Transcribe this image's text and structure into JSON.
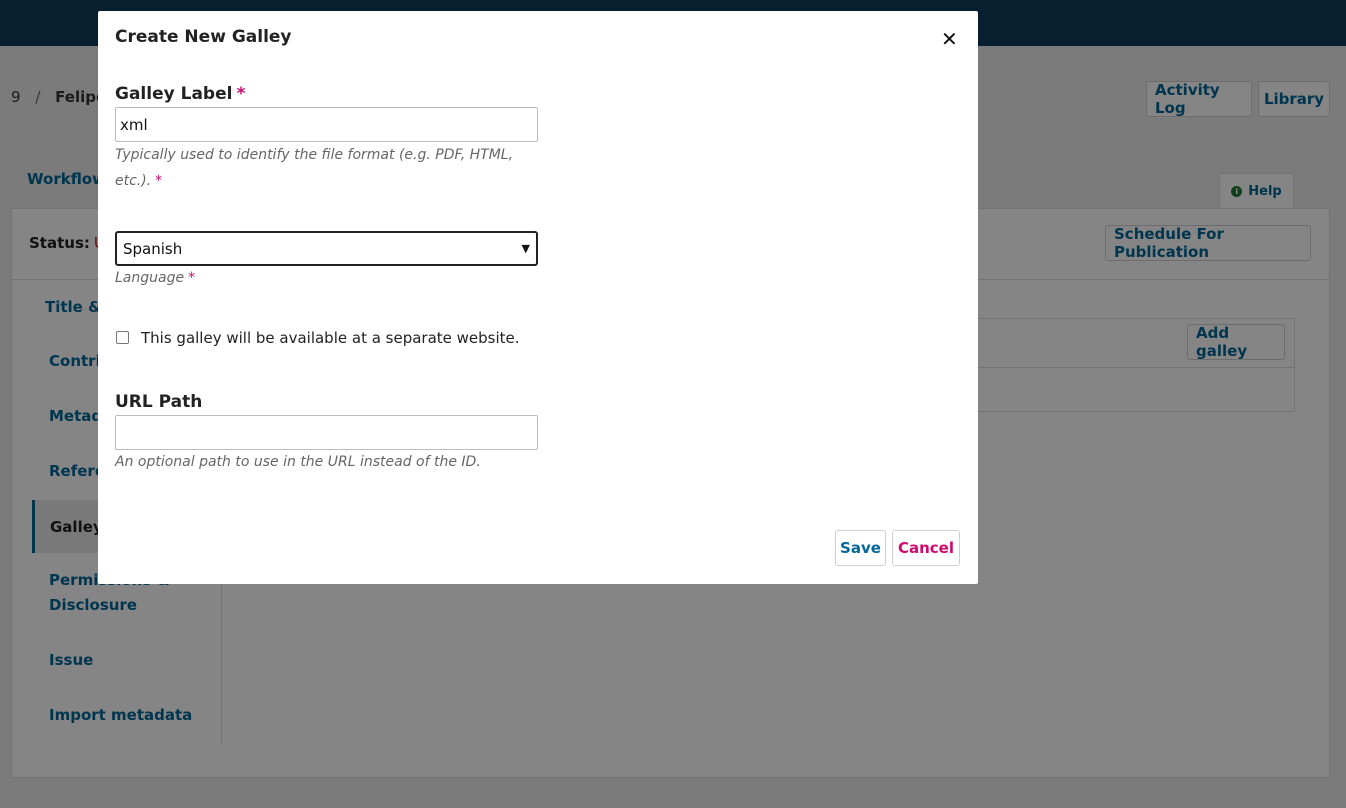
{
  "page": {
    "breadcrumb": {
      "id": "9",
      "separator": "/",
      "author": "Felipe"
    },
    "header_buttons": {
      "activity_log": "Activity Log",
      "library": "Library"
    },
    "tabs": {
      "workflow": "Workflow"
    },
    "help": {
      "label": "Help",
      "icon": "info-icon"
    },
    "status": {
      "label": "Status:",
      "value": "U"
    },
    "schedule_button": "Schedule For Publication",
    "sidebar": {
      "items": [
        {
          "label": "Title &"
        },
        {
          "label": "Contri"
        },
        {
          "label": "Metad"
        },
        {
          "label": "Refere"
        },
        {
          "label": "Galley"
        },
        {
          "label": "Permissions &"
        },
        {
          "label": "Disclosure"
        },
        {
          "label": "Issue"
        },
        {
          "label": "Import metadata"
        }
      ]
    },
    "galleys": {
      "add_button": "Add galley"
    }
  },
  "modal": {
    "title": "Create New Galley",
    "close_icon": "close-icon",
    "galley_label": {
      "label": "Galley Label",
      "required_mark": "*",
      "value": "xml",
      "description_line1": "Typically used to identify the file format (e.g. PDF, HTML,",
      "description_line2": "etc.)."
    },
    "language": {
      "selected": "Spanish",
      "caption": "Language",
      "required_mark": "*"
    },
    "remote": {
      "label": "This galley will be available at a separate website.",
      "checked": false
    },
    "url_path": {
      "label": "URL Path",
      "value": "",
      "description": "An optional path to use in the URL instead of the ID."
    },
    "save_label": "Save",
    "cancel_label": "Cancel"
  },
  "colors": {
    "primary_link": "#006798",
    "required": "#d00a6c",
    "cancel": "#d00a6c",
    "status_red": "#d00a0a",
    "topbar": "#0e3d5a"
  }
}
